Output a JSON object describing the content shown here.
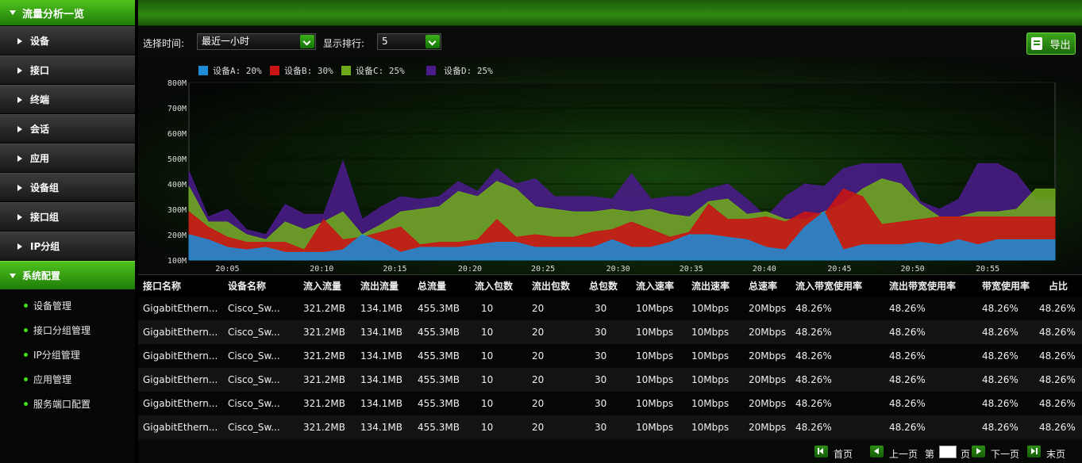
{
  "sidebar": {
    "title": "流量分析一览",
    "items": [
      {
        "label": "设备"
      },
      {
        "label": "接口"
      },
      {
        "label": "终端"
      },
      {
        "label": "会话"
      },
      {
        "label": "应用"
      },
      {
        "label": "设备组"
      },
      {
        "label": "接口组"
      },
      {
        "label": "IP分组"
      }
    ],
    "active": {
      "label": "系统配置"
    },
    "subitems": [
      {
        "label": "设备管理"
      },
      {
        "label": "接口分组管理"
      },
      {
        "label": "IP分组管理"
      },
      {
        "label": "应用管理"
      },
      {
        "label": "服务端口配置"
      }
    ]
  },
  "controls": {
    "time_label": "选择时间:",
    "time_value": "最近一小时",
    "rank_label": "显示排行:",
    "rank_value": "5",
    "export_label": "导出"
  },
  "colors": {
    "deviceA": "#1f8ad6",
    "deviceB": "#c81414",
    "deviceC": "#6ea81c",
    "deviceD": "#4a1b8a",
    "accent": "#3bb218"
  },
  "chart_data": {
    "type": "area",
    "stacked": false,
    "legend": [
      {
        "label": "设备A: 20%",
        "key": "deviceA"
      },
      {
        "label": "设备B: 30%",
        "key": "deviceB"
      },
      {
        "label": "设备C: 25%",
        "key": "deviceC"
      },
      {
        "label": "设备D: 25%",
        "key": "deviceD"
      }
    ],
    "legend_position": "top-left",
    "yticks": [
      "800M",
      "700M",
      "600M",
      "500M",
      "400M",
      "300M",
      "200M",
      "100M"
    ],
    "ylim": [
      100,
      800
    ],
    "xticks": [
      "20:05",
      "20:10",
      "20:15",
      "20:20",
      "20:25",
      "20:30",
      "20:35",
      "20:40",
      "20:45",
      "20:50",
      "20:55"
    ],
    "xlim": [
      0,
      36
    ],
    "xtick_positions": [
      2,
      6.9,
      10.7,
      14.6,
      18.4,
      22.3,
      26.1,
      29.9,
      33.8,
      37.6,
      41.5
    ],
    "grid": true,
    "x": [
      0,
      1,
      2,
      3,
      4,
      5,
      6,
      7,
      8,
      9,
      10,
      11,
      12,
      13,
      14,
      15,
      16,
      17,
      18,
      19,
      20,
      21,
      22,
      23,
      24,
      25,
      26,
      27,
      28,
      29,
      30,
      31,
      32,
      33,
      34,
      35,
      36,
      37,
      38,
      39,
      40,
      41,
      42,
      43,
      44,
      45
    ],
    "series": [
      {
        "key": "deviceD",
        "values": [
          450,
          270,
          300,
          220,
          200,
          320,
          280,
          280,
          490,
          260,
          310,
          350,
          340,
          350,
          410,
          370,
          460,
          400,
          420,
          350,
          350,
          350,
          340,
          440,
          340,
          350,
          350,
          380,
          400,
          340,
          270,
          350,
          400,
          390,
          460,
          480,
          480,
          480,
          330,
          300,
          340,
          480,
          480,
          440,
          340,
          340
        ]
      },
      {
        "key": "deviceC",
        "values": [
          390,
          250,
          250,
          200,
          180,
          250,
          220,
          250,
          290,
          200,
          240,
          290,
          300,
          310,
          370,
          350,
          410,
          380,
          310,
          300,
          290,
          290,
          300,
          290,
          300,
          280,
          270,
          330,
          340,
          280,
          290,
          260,
          260,
          290,
          320,
          380,
          420,
          400,
          320,
          270,
          270,
          290,
          290,
          300,
          380,
          380
        ]
      },
      {
        "key": "deviceB",
        "values": [
          290,
          230,
          190,
          170,
          170,
          170,
          140,
          260,
          180,
          190,
          210,
          230,
          160,
          170,
          170,
          180,
          260,
          190,
          200,
          190,
          190,
          210,
          220,
          250,
          220,
          190,
          210,
          320,
          260,
          260,
          270,
          250,
          290,
          280,
          380,
          350,
          240,
          250,
          260,
          270,
          270,
          270,
          270,
          270,
          270,
          270
        ]
      },
      {
        "key": "deviceA",
        "values": [
          200,
          180,
          150,
          140,
          150,
          130,
          130,
          130,
          140,
          200,
          170,
          130,
          150,
          150,
          150,
          160,
          170,
          170,
          150,
          150,
          150,
          150,
          180,
          150,
          150,
          170,
          200,
          200,
          190,
          180,
          150,
          140,
          230,
          290,
          140,
          160,
          160,
          160,
          170,
          160,
          180,
          160,
          180,
          180,
          180,
          180
        ]
      }
    ]
  },
  "table": {
    "headers": [
      "接口名称",
      "设备名称",
      "流入流量",
      "流出流量",
      "总流量",
      "流入包数",
      "流出包数",
      "总包数",
      "流入速率",
      "流出速率",
      "总速率",
      "流入带宽使用率",
      "流出带宽使用率",
      "带宽使用率",
      "占比"
    ],
    "rows": [
      [
        "GigabitEthern...",
        "Cisco_Sw...",
        "321.2MB",
        "134.1MB",
        "455.3MB",
        "10",
        "20",
        "30",
        "10Mbps",
        "10Mbps",
        "20Mbps",
        "48.26%",
        "48.26%",
        "48.26%",
        "48.26%"
      ],
      [
        "GigabitEthern...",
        "Cisco_Sw...",
        "321.2MB",
        "134.1MB",
        "455.3MB",
        "10",
        "20",
        "30",
        "10Mbps",
        "10Mbps",
        "20Mbps",
        "48.26%",
        "48.26%",
        "48.26%",
        "48.26%"
      ],
      [
        "GigabitEthern...",
        "Cisco_Sw...",
        "321.2MB",
        "134.1MB",
        "455.3MB",
        "10",
        "20",
        "30",
        "10Mbps",
        "10Mbps",
        "20Mbps",
        "48.26%",
        "48.26%",
        "48.26%",
        "48.26%"
      ],
      [
        "GigabitEthern...",
        "Cisco_Sw...",
        "321.2MB",
        "134.1MB",
        "455.3MB",
        "10",
        "20",
        "30",
        "10Mbps",
        "10Mbps",
        "20Mbps",
        "48.26%",
        "48.26%",
        "48.26%",
        "48.26%"
      ],
      [
        "GigabitEthern...",
        "Cisco_Sw...",
        "321.2MB",
        "134.1MB",
        "455.3MB",
        "10",
        "20",
        "30",
        "10Mbps",
        "10Mbps",
        "20Mbps",
        "48.26%",
        "48.26%",
        "48.26%",
        "48.26%"
      ],
      [
        "GigabitEthern...",
        "Cisco_Sw...",
        "321.2MB",
        "134.1MB",
        "455.3MB",
        "10",
        "20",
        "30",
        "10Mbps",
        "10Mbps",
        "20Mbps",
        "48.26%",
        "48.26%",
        "48.26%",
        "48.26%"
      ]
    ]
  },
  "pager": {
    "first": "首页",
    "prev": "上一页",
    "page_prefix": "第",
    "page_suffix": "页",
    "next": "下一页",
    "last": "末页"
  }
}
